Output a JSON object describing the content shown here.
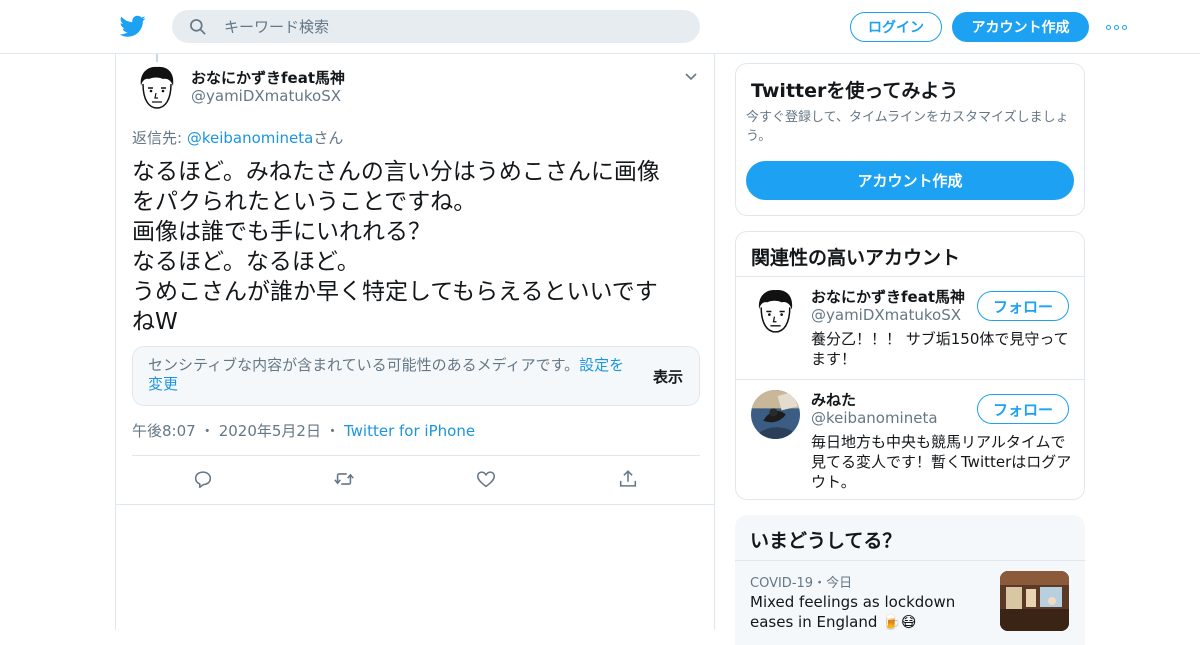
{
  "header": {
    "logo_icon": "twitter-bird-icon",
    "search_placeholder": "キーワード検索",
    "login_label": "ログイン",
    "signup_label": "アカウント作成",
    "more_icon": "more-dots-icon"
  },
  "tweet": {
    "author_name": "おなにかずきfeat馬神",
    "author_handle": "@yamiDXmatukoSX",
    "reply_prefix": "返信先: ",
    "reply_handle": "@keibanomineta",
    "reply_suffix": "さん",
    "text": "なるほど。みねたさんの言い分はうめこさんに画像\nをパクられたということですね。\n画像は誰でも手にいれれる？\nなるほど。なるほど。\nうめこさんが誰か早く特定してもらえるといいです\nねW",
    "sensitive_text": "センシティブな内容が含まれている可能性のあるメディアです。",
    "sensitive_link": "設定を変更",
    "sensitive_show": "表示",
    "time": "午後8:07",
    "date": "2020年5月2日",
    "source": "Twitter for iPhone",
    "sep": "・"
  },
  "signup_card": {
    "title": "Twitterを使ってみよう",
    "desc": "今すぐ登録して、タイムラインをカスタマイズしましょう。",
    "button": "アカウント作成"
  },
  "related": {
    "title": "関連性の高いアカウント",
    "accounts": [
      {
        "name": "おなにかずきfeat馬神",
        "handle": "@yamiDXmatukoSX",
        "bio": "養分乙！！！ サブ垢150体で見守ってます！",
        "follow": "フォロー"
      },
      {
        "name": "みねた",
        "handle": "@keibanomineta",
        "bio": "毎日地方も中央も競馬リアルタイムで見てる変人です！暫くTwitterはログアウト。",
        "follow": "フォロー"
      }
    ]
  },
  "trends": {
    "title": "いまどうしてる？",
    "item": {
      "category": "COVID-19",
      "sep": "・",
      "when": "今日",
      "headline": "Mixed feelings as lockdown eases in England 🍺😷"
    }
  },
  "colors": {
    "accent": "#1da1f2",
    "link": "#1b95e0",
    "muted": "#657786",
    "border": "#e1e8ed"
  }
}
